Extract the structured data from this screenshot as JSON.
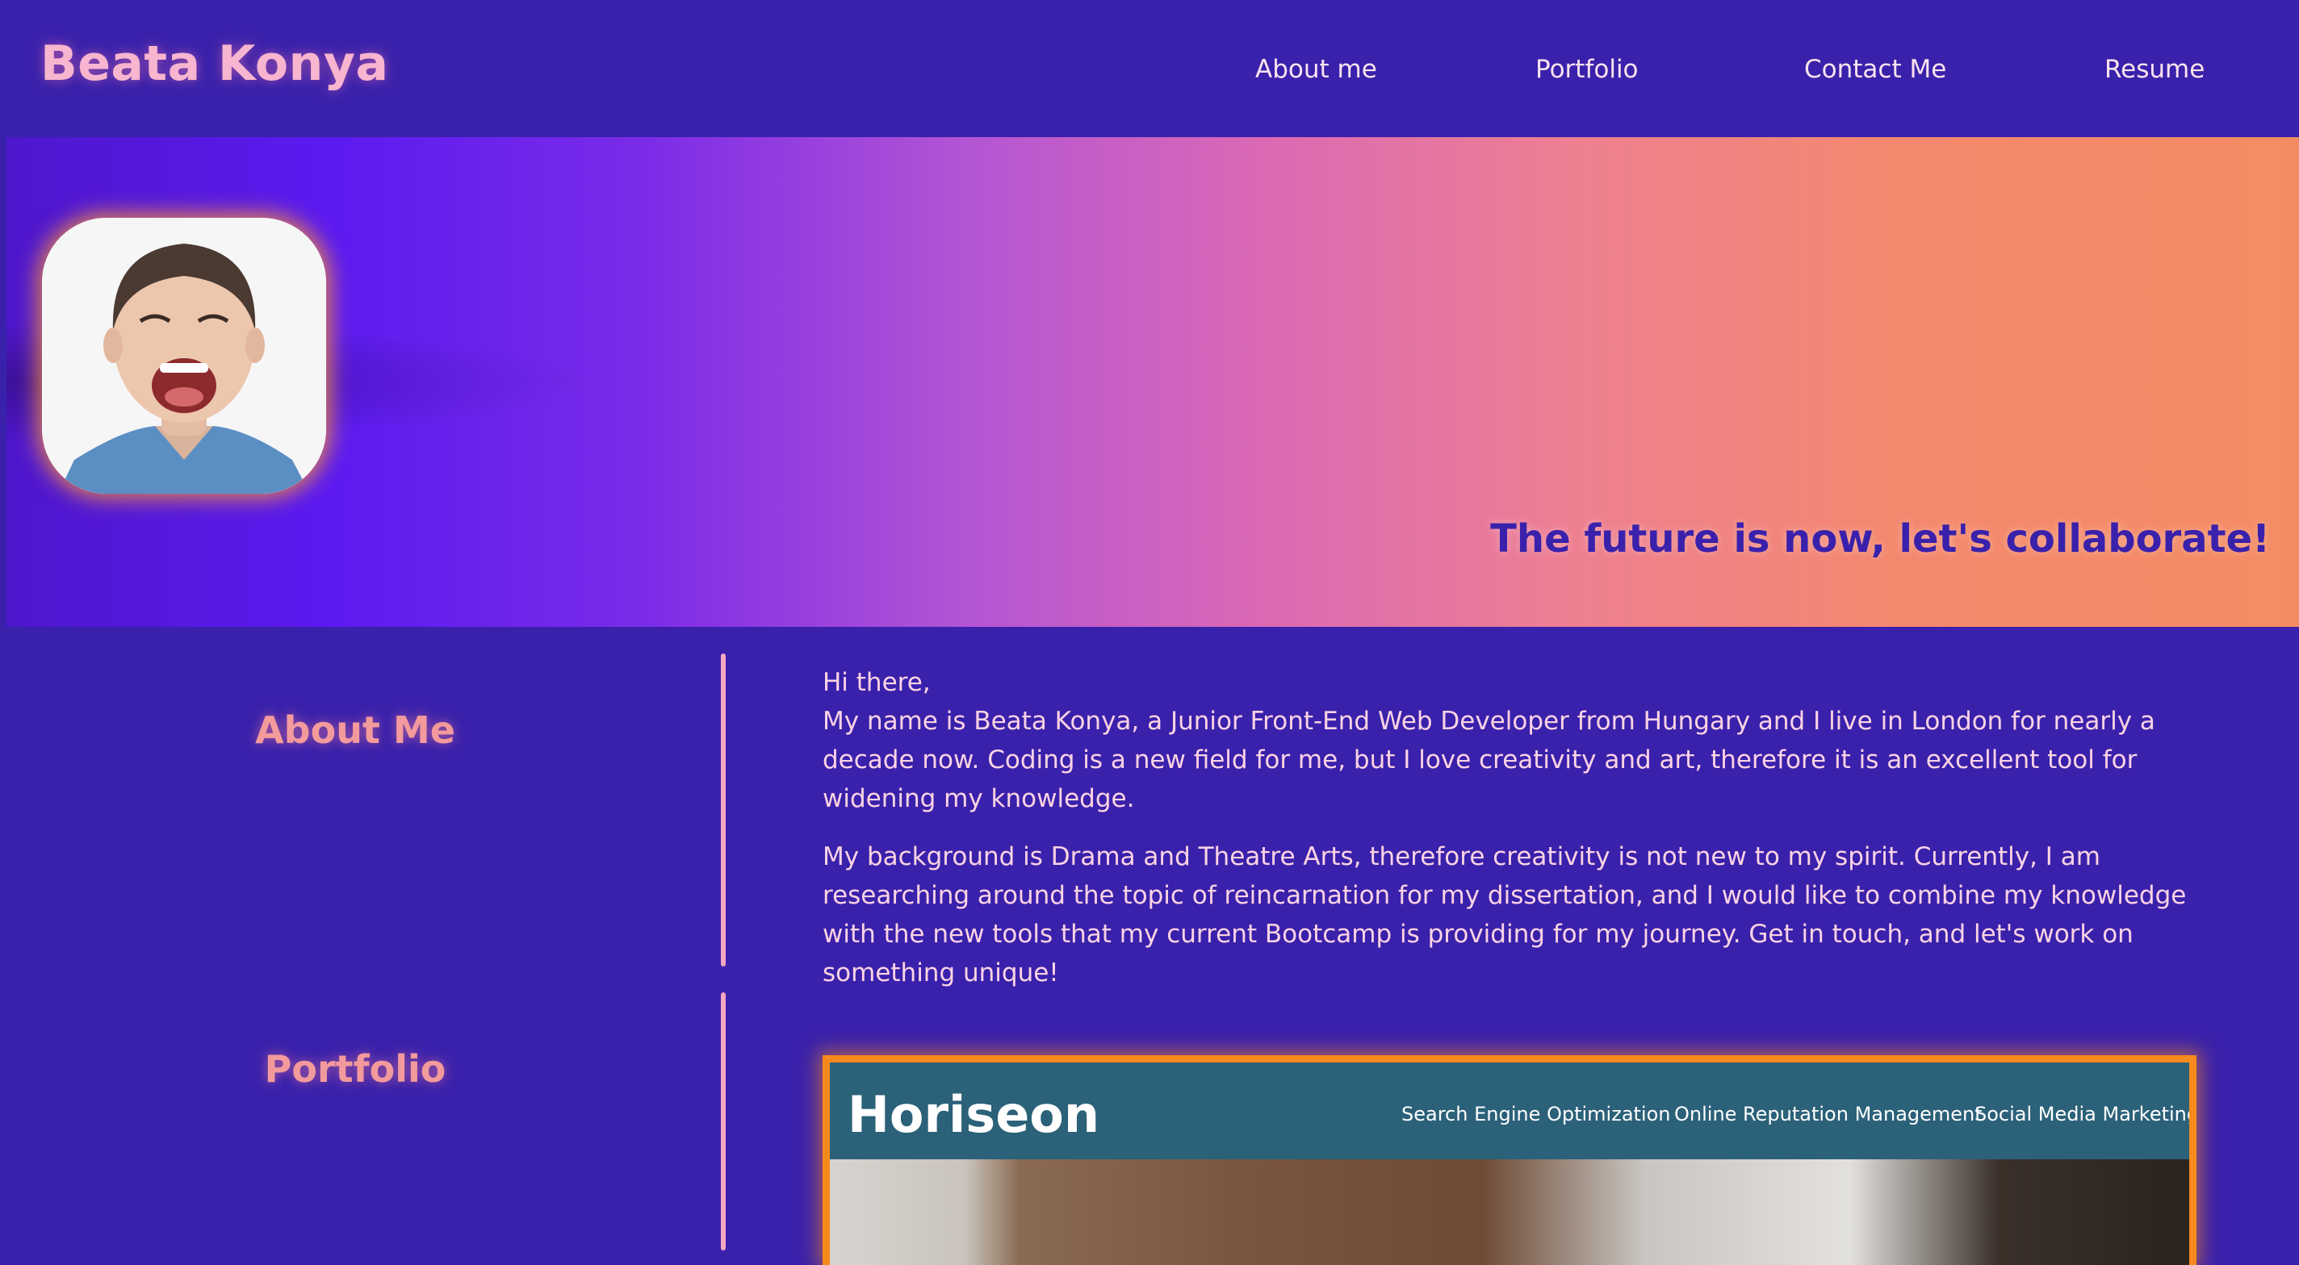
{
  "header": {
    "brand": "Beata Konya",
    "nav": [
      "About me",
      "Portfolio",
      "Contact Me",
      "Resume"
    ]
  },
  "hero": {
    "tagline": "The future is now, let's collaborate!"
  },
  "about": {
    "title": "About Me",
    "paragraphs": [
      "Hi there,",
      "My name is Beata Konya, a Junior Front-End Web Developer from Hungary and I live in London for nearly a decade now. Coding is a new field for me, but I love creativity and art, therefore it is an excellent tool for widening my knowledge.",
      "My background is Drama and Theatre Arts, therefore creativity is not new to my spirit. Currently, I am researching around the topic of reincarnation for my dissertation, and I would like to combine my knowledge with the new tools that my current Bootcamp is providing for my journey. Get in touch, and let's work on something unique!"
    ]
  },
  "portfolio": {
    "title": "Portfolio",
    "project": {
      "logo": "Horiseon",
      "nav": [
        "Search Engine Optimization",
        "Online Reputation Management",
        "Social Media Marketing"
      ]
    }
  },
  "colors": {
    "background": "#3a21ab",
    "brand": "#f8b5cf",
    "accent": "#f78a1c",
    "section_title": "#f29a9c"
  }
}
